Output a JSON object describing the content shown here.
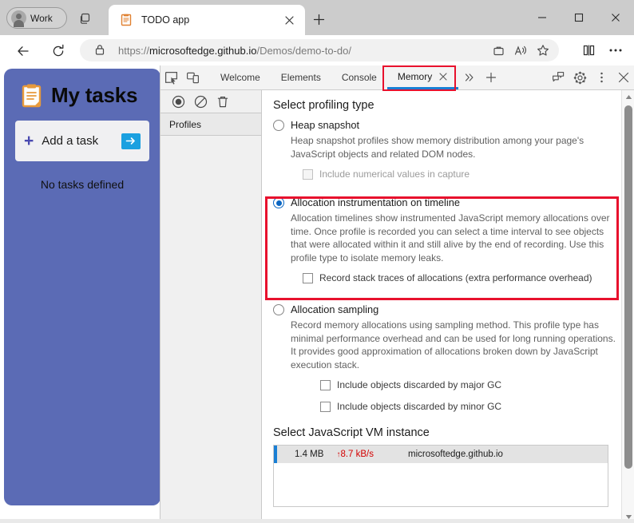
{
  "browser": {
    "profile_label": "Work",
    "tab_search_icon": "tab-search-icon",
    "tab": {
      "title": "TODO app",
      "favicon": "clipboard-favicon",
      "close_icon": "close-icon"
    },
    "new_tab_icon": "plus-icon",
    "window_controls": {
      "minimize": "minimize-icon",
      "maximize": "maximize-icon",
      "close": "close-icon"
    },
    "nav": {
      "back_icon": "arrow-left-icon",
      "reload_icon": "reload-icon"
    },
    "omnibox": {
      "lock_icon": "lock-icon",
      "url_scheme": "https://",
      "url_host": "microsoftedge.github.io",
      "url_path": "/Demos/demo-to-do/",
      "actions": [
        {
          "name": "collections-icon"
        },
        {
          "name": "read-aloud-icon"
        },
        {
          "name": "favorite-star-icon"
        }
      ]
    },
    "right_icons": [
      {
        "name": "split-screen-icon"
      },
      {
        "name": "settings-more-icon"
      }
    ]
  },
  "page": {
    "title": "My tasks",
    "title_icon": "clipboard-icon",
    "add_task_label": "Add a task",
    "add_task_plus": "+",
    "add_task_go_icon": "arrow-right-icon",
    "empty_message": "No tasks defined"
  },
  "devtools": {
    "toolbar_left_icons": [
      {
        "name": "inspect-element-icon"
      },
      {
        "name": "device-emulation-icon"
      }
    ],
    "tabs": [
      {
        "label": "Welcome",
        "active": false
      },
      {
        "label": "Elements",
        "active": false
      },
      {
        "label": "Console",
        "active": false
      },
      {
        "label": "Memory",
        "active": true,
        "closable": true
      }
    ],
    "more_tabs_icon": "chevron-double-right-icon",
    "add_tab_icon": "plus-icon",
    "toolbar_right_icons": [
      {
        "name": "feedback-icon"
      },
      {
        "name": "gear-icon"
      },
      {
        "name": "more-vertical-icon"
      },
      {
        "name": "close-icon"
      }
    ],
    "record_controls": [
      {
        "name": "record-icon"
      },
      {
        "name": "clear-icon"
      },
      {
        "name": "delete-icon"
      }
    ],
    "sidebar_header": "Profiles",
    "main": {
      "profiling_title": "Select profiling type",
      "options": [
        {
          "id": "heap-snapshot",
          "label": "Heap snapshot",
          "selected": false,
          "description": "Heap snapshot profiles show memory distribution among your page's JavaScript objects and related DOM nodes.",
          "checkboxes": [
            {
              "label": "Include numerical values in capture",
              "checked": false,
              "disabled": true
            }
          ]
        },
        {
          "id": "allocation-instrumentation-on-timeline",
          "label": "Allocation instrumentation on timeline",
          "selected": true,
          "description": "Allocation timelines show instrumented JavaScript memory allocations over time. Once profile is recorded you can select a time interval to see objects that were allocated within it and still alive by the end of recording. Use this profile type to isolate memory leaks.",
          "checkboxes": [
            {
              "label": "Record stack traces of allocations (extra performance overhead)",
              "checked": false,
              "disabled": false
            }
          ]
        },
        {
          "id": "allocation-sampling",
          "label": "Allocation sampling",
          "selected": false,
          "description": "Record memory allocations using sampling method. This profile type has minimal performance overhead and can be used for long running operations. It provides good approximation of allocations broken down by JavaScript execution stack.",
          "checkboxes": [
            {
              "label": "Include objects discarded by major GC",
              "checked": false,
              "disabled": false
            },
            {
              "label": "Include objects discarded by minor GC",
              "checked": false,
              "disabled": false
            }
          ]
        }
      ],
      "vm_title": "Select JavaScript VM instance",
      "vm_rows": [
        {
          "size": "1.4 MB",
          "rate_arrow": "↑",
          "rate": "8.7 kB/s",
          "host": "microsoftedge.github.io"
        }
      ]
    },
    "scrollbar": {
      "up_icon": "scroll-up-icon",
      "down_icon": "scroll-down-icon"
    }
  },
  "colors": {
    "accent_blue": "#1a7fd4",
    "radio_blue": "#0a66c2",
    "highlight_red": "#e8112d",
    "page_purple": "#5b6bb5",
    "rate_red": "#d40000"
  }
}
